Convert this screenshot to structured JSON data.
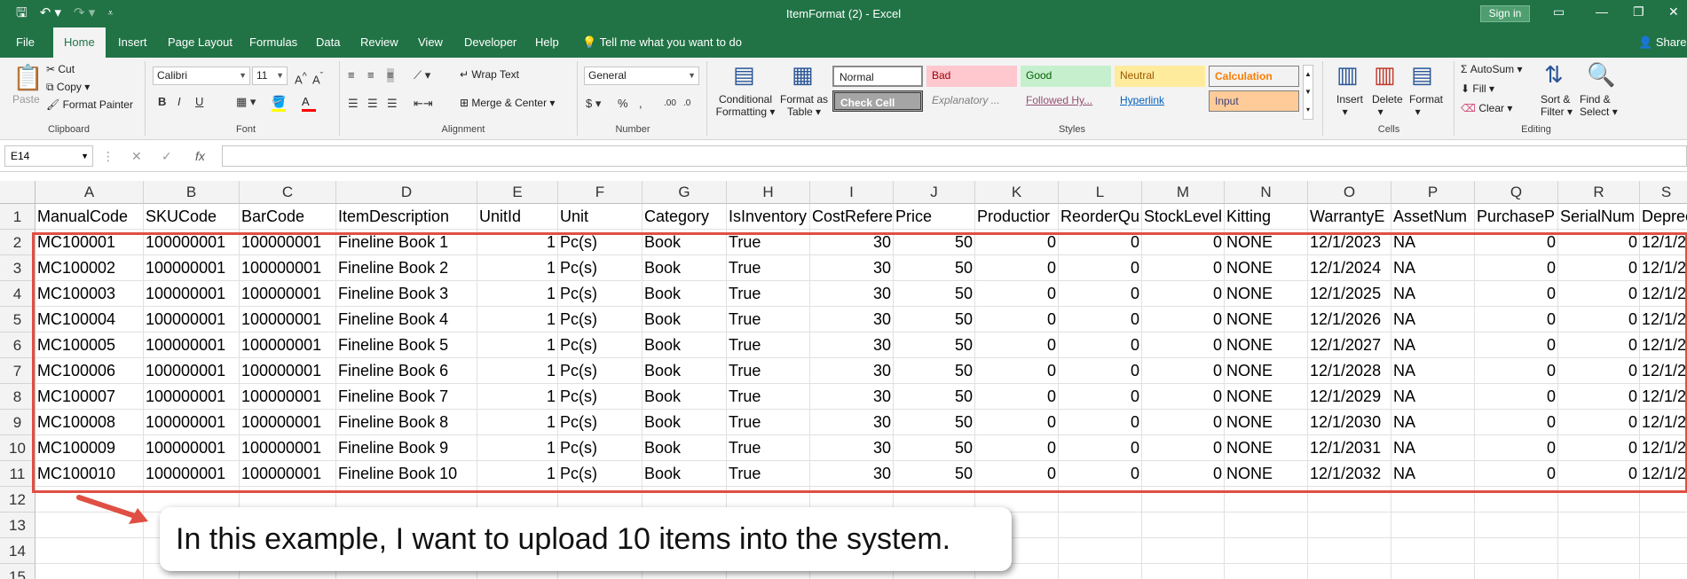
{
  "window": {
    "title": "ItemFormat (2)  -  Excel",
    "signin_label": "Sign in"
  },
  "tabs": [
    {
      "label": "File"
    },
    {
      "label": "Home"
    },
    {
      "label": "Insert"
    },
    {
      "label": "Page Layout"
    },
    {
      "label": "Formulas"
    },
    {
      "label": "Data"
    },
    {
      "label": "Review"
    },
    {
      "label": "View"
    },
    {
      "label": "Developer"
    },
    {
      "label": "Help"
    }
  ],
  "tell_me": "Tell me what you want to do",
  "share": "Share",
  "ribbon": {
    "clipboard": {
      "paste": "Paste",
      "cut": "Cut",
      "copy": "Copy",
      "format_painter": "Format Painter",
      "label": "Clipboard"
    },
    "font": {
      "name": "Calibri",
      "size": "11",
      "bold": "B",
      "italic": "I",
      "underline": "U",
      "label": "Font"
    },
    "alignment": {
      "wrap_text": "Wrap Text",
      "merge_center": "Merge & Center",
      "label": "Alignment"
    },
    "number": {
      "format": "General",
      "label": "Number"
    },
    "styles": {
      "conditional": "Conditional Formatting",
      "conditional_1": "Conditional",
      "conditional_2": "Formatting",
      "format_as_1": "Format as",
      "format_as_2": "Table",
      "items": {
        "normal": "Normal",
        "bad": "Bad",
        "good": "Good",
        "neutral": "Neutral",
        "calculation": "Calculation",
        "check_cell": "Check Cell",
        "explanatory": "Explanatory ...",
        "followed": "Followed Hy...",
        "hyperlink": "Hyperlink",
        "input": "Input"
      },
      "label": "Styles"
    },
    "cells": {
      "insert": "Insert",
      "delete": "Delete",
      "format": "Format",
      "label": "Cells"
    },
    "editing": {
      "autosum": "AutoSum",
      "fill": "Fill",
      "clear": "Clear",
      "sort_1": "Sort &",
      "sort_2": "Filter",
      "find_1": "Find &",
      "find_2": "Select",
      "label": "Editing"
    },
    "colors": {
      "fill": "#ffff00",
      "font": "#ff0000",
      "bad_bg": "#ffc7ce",
      "good_bg": "#c6efce",
      "neutral_bg": "#ffeb9c",
      "calc_bg": "#f2f2f2",
      "check_bg": "#a5a5a5",
      "input_bg": "#ffcc99"
    }
  },
  "formula_bar": {
    "name_box": "E14",
    "fx": "fx",
    "value": ""
  },
  "columns": [
    "A",
    "B",
    "C",
    "D",
    "E",
    "F",
    "G",
    "H",
    "I",
    "J",
    "K",
    "L",
    "M",
    "N",
    "O",
    "P",
    "Q",
    "R",
    "S"
  ],
  "row_numbers": [
    "1",
    "2",
    "3",
    "4",
    "5",
    "6",
    "7",
    "8",
    "9",
    "10",
    "11",
    "12",
    "13",
    "14",
    "15"
  ],
  "headers": [
    "ManualCode",
    "SKUCode",
    "BarCode",
    "ItemDescription",
    "UnitId",
    "Unit",
    "Category",
    "IsInventory",
    "CostRefere",
    "Price",
    "Productior",
    "ReorderQu",
    "StockLevel",
    "Kitting",
    "WarrantyE",
    "AssetNum",
    "PurchaseP",
    "SerialNum",
    "Deprec"
  ],
  "rows": [
    [
      "MC100001",
      "100000001",
      "100000001",
      "Fineline Book 1",
      "1",
      "Pc(s)",
      "Book",
      "True",
      "30",
      "50",
      "0",
      "0",
      "0",
      "NONE",
      "12/1/2023",
      "NA",
      "0",
      "0",
      "12/1/2"
    ],
    [
      "MC100002",
      "100000001",
      "100000001",
      "Fineline Book 2",
      "1",
      "Pc(s)",
      "Book",
      "True",
      "30",
      "50",
      "0",
      "0",
      "0",
      "NONE",
      "12/1/2024",
      "NA",
      "0",
      "0",
      "12/1/2"
    ],
    [
      "MC100003",
      "100000001",
      "100000001",
      "Fineline Book 3",
      "1",
      "Pc(s)",
      "Book",
      "True",
      "30",
      "50",
      "0",
      "0",
      "0",
      "NONE",
      "12/1/2025",
      "NA",
      "0",
      "0",
      "12/1/2"
    ],
    [
      "MC100004",
      "100000001",
      "100000001",
      "Fineline Book 4",
      "1",
      "Pc(s)",
      "Book",
      "True",
      "30",
      "50",
      "0",
      "0",
      "0",
      "NONE",
      "12/1/2026",
      "NA",
      "0",
      "0",
      "12/1/2"
    ],
    [
      "MC100005",
      "100000001",
      "100000001",
      "Fineline Book 5",
      "1",
      "Pc(s)",
      "Book",
      "True",
      "30",
      "50",
      "0",
      "0",
      "0",
      "NONE",
      "12/1/2027",
      "NA",
      "0",
      "0",
      "12/1/2"
    ],
    [
      "MC100006",
      "100000001",
      "100000001",
      "Fineline Book 6",
      "1",
      "Pc(s)",
      "Book",
      "True",
      "30",
      "50",
      "0",
      "0",
      "0",
      "NONE",
      "12/1/2028",
      "NA",
      "0",
      "0",
      "12/1/2"
    ],
    [
      "MC100007",
      "100000001",
      "100000001",
      "Fineline Book 7",
      "1",
      "Pc(s)",
      "Book",
      "True",
      "30",
      "50",
      "0",
      "0",
      "0",
      "NONE",
      "12/1/2029",
      "NA",
      "0",
      "0",
      "12/1/2"
    ],
    [
      "MC100008",
      "100000001",
      "100000001",
      "Fineline Book 8",
      "1",
      "Pc(s)",
      "Book",
      "True",
      "30",
      "50",
      "0",
      "0",
      "0",
      "NONE",
      "12/1/2030",
      "NA",
      "0",
      "0",
      "12/1/2"
    ],
    [
      "MC100009",
      "100000001",
      "100000001",
      "Fineline Book 9",
      "1",
      "Pc(s)",
      "Book",
      "True",
      "30",
      "50",
      "0",
      "0",
      "0",
      "NONE",
      "12/1/2031",
      "NA",
      "0",
      "0",
      "12/1/2"
    ],
    [
      "MC100010",
      "100000001",
      "100000001",
      "Fineline Book 10",
      "1",
      "Pc(s)",
      "Book",
      "True",
      "30",
      "50",
      "0",
      "0",
      "0",
      "NONE",
      "12/1/2032",
      "NA",
      "0",
      "0",
      "12/1/2"
    ]
  ],
  "callout": "In this example, I want to upload 10 items into the system.",
  "accent": {
    "excel_green": "#217346",
    "highlight": "#e04f43"
  }
}
